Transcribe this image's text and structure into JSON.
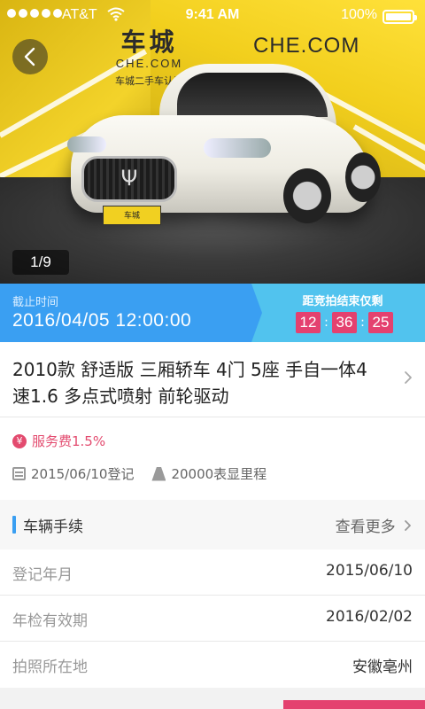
{
  "status_bar": {
    "carrier": "AT&T",
    "time": "9:41 AM",
    "battery": "100%",
    "signal_icon": "signal-dots-icon",
    "wifi_icon": "wifi-icon",
    "battery_icon": "battery-icon"
  },
  "gallery": {
    "counter": "1/9",
    "back_icon": "chevron-left-icon",
    "logo_cn": "车城",
    "logo_en": "CHE.COM",
    "logo_tagline": "车城二手车认证",
    "wall_sign": "CHE.COM",
    "plate_text": "车城"
  },
  "auction": {
    "deadline_label": "截止时间",
    "deadline_value": "2016/04/05 12:00:00",
    "countdown_label": "距竞拍结束仅剩",
    "hours": "12",
    "minutes": "36",
    "seconds": "25",
    "separator": ":"
  },
  "car": {
    "title": "2010款 舒适版 三厢轿车 4门 5座 手自一体4速1.6 多点式喷射 前轮驱动",
    "service_fee": "服务费1.5%",
    "service_fee_icon": "¥",
    "registration": "2015/06/10登记",
    "mileage": "20000表显里程"
  },
  "procedures": {
    "title": "车辆手续",
    "see_more": "查看更多",
    "rows": [
      {
        "label": "登记年月",
        "value": "2015/06/10"
      },
      {
        "label": "年检有效期",
        "value": "2016/02/02"
      },
      {
        "label": "拍照所在地",
        "value": "安徽亳州"
      }
    ]
  },
  "colors": {
    "accent_blue": "#3a9ff2",
    "light_blue": "#51c3ee",
    "countdown_pink": "#e4416f",
    "fee_red": "#e34b6f"
  }
}
